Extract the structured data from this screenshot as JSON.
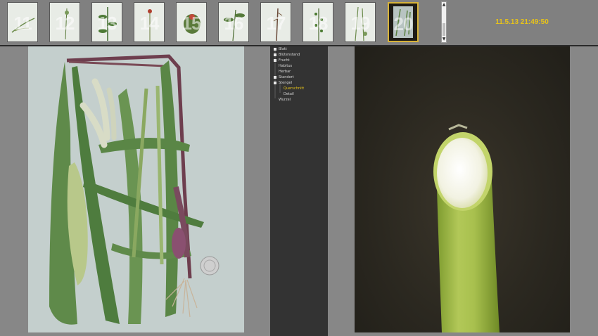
{
  "thumbnails": [
    {
      "label": "11",
      "selected": false
    },
    {
      "label": "12",
      "selected": false
    },
    {
      "label": "13",
      "selected": false
    },
    {
      "label": "14",
      "selected": false
    },
    {
      "label": "15",
      "selected": false
    },
    {
      "label": "16",
      "selected": false
    },
    {
      "label": "17",
      "selected": false
    },
    {
      "label": "18",
      "selected": false
    },
    {
      "label": "19",
      "selected": false
    },
    {
      "label": "20",
      "selected": true
    }
  ],
  "datetime": "11.5.13 21:49:50",
  "tree": [
    {
      "label": "Blatt",
      "expandable": true,
      "active": false
    },
    {
      "label": "Blütenstand",
      "expandable": true,
      "active": false
    },
    {
      "label": "Frucht",
      "expandable": true,
      "active": false
    },
    {
      "label": "Habitus",
      "expandable": false,
      "active": false
    },
    {
      "label": "Herbar",
      "expandable": false,
      "active": false
    },
    {
      "label": "Standort",
      "expandable": true,
      "active": false
    },
    {
      "label": "Stengel",
      "expandable": true,
      "active": false
    },
    {
      "label": "Querschnitt",
      "expandable": false,
      "active": true
    },
    {
      "label": "Detail",
      "expandable": false,
      "active": false
    },
    {
      "label": "Wurzel",
      "expandable": false,
      "active": false
    }
  ],
  "colors": {
    "accent": "#e6c21a",
    "panel_bg": "#878787",
    "tree_bg": "#333333"
  }
}
